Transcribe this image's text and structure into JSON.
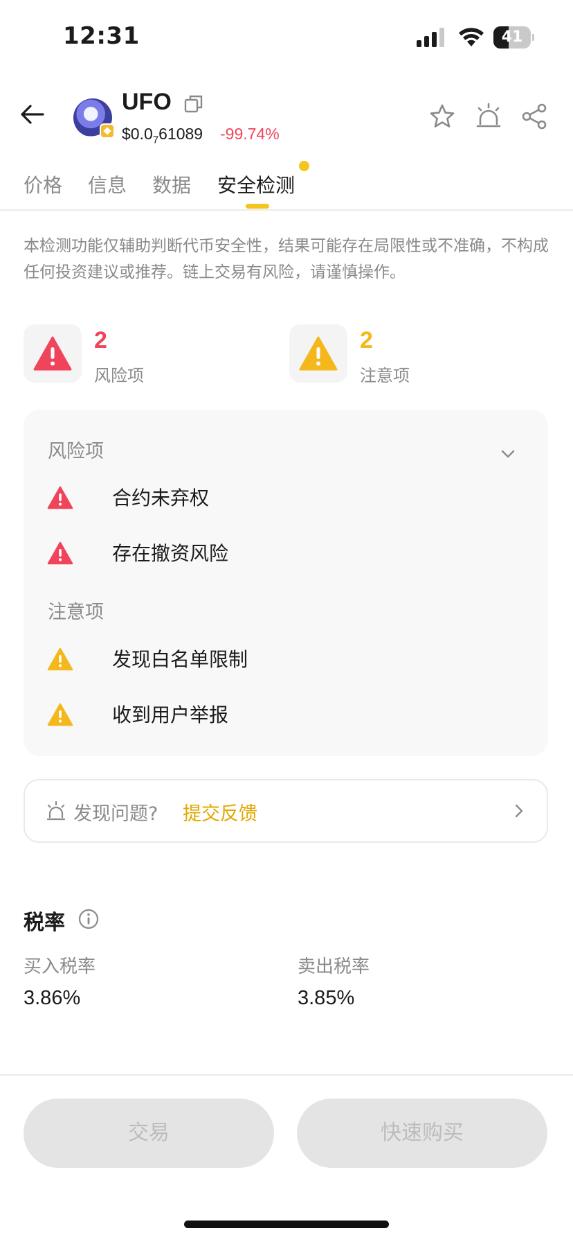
{
  "status_bar": {
    "time": "12:31",
    "battery": "41",
    "battery_level": 0.41
  },
  "token": {
    "symbol": "UFO",
    "price_prefix": "$0.0",
    "price_sub": "7",
    "price_rest": "61089",
    "change": "-99.74%"
  },
  "tabs": [
    {
      "label": "价格"
    },
    {
      "label": "信息"
    },
    {
      "label": "数据"
    },
    {
      "label": "安全检测",
      "active": true
    }
  ],
  "disclaimer": "本检测功能仅辅助判断代币安全性，结果可能存在局限性或不准确，不构成任何投资建议或推荐。链上交易有风险，请谨慎操作。",
  "summary": {
    "risk": {
      "count": "2",
      "label": "风险项"
    },
    "warn": {
      "count": "2",
      "label": "注意项"
    }
  },
  "risk_section": {
    "title": "风险项",
    "items": [
      {
        "label": "合约未弃权"
      },
      {
        "label": "存在撤资风险"
      }
    ]
  },
  "warn_section": {
    "title": "注意项",
    "items": [
      {
        "label": "发现白名单限制"
      },
      {
        "label": "收到用户举报"
      }
    ]
  },
  "feedback": {
    "question": "发现问题?",
    "link": "提交反馈"
  },
  "tax": {
    "title": "税率",
    "buy": {
      "label": "买入税率",
      "value": "3.86%"
    },
    "sell": {
      "label": "卖出税率",
      "value": "3.85%"
    }
  },
  "buttons": {
    "trade": "交易",
    "quick_buy": "快速购买"
  },
  "colors": {
    "risk": "#f0445b",
    "warn": "#f5b81c",
    "accent": "#f5c51f",
    "link": "#e0a800"
  },
  "icons": [
    "back-arrow-icon",
    "copy-icon",
    "star-icon",
    "alarm-icon",
    "share-icon",
    "warning-triangle-icon",
    "chevron-down-icon",
    "chevron-right-icon",
    "info-icon"
  ]
}
